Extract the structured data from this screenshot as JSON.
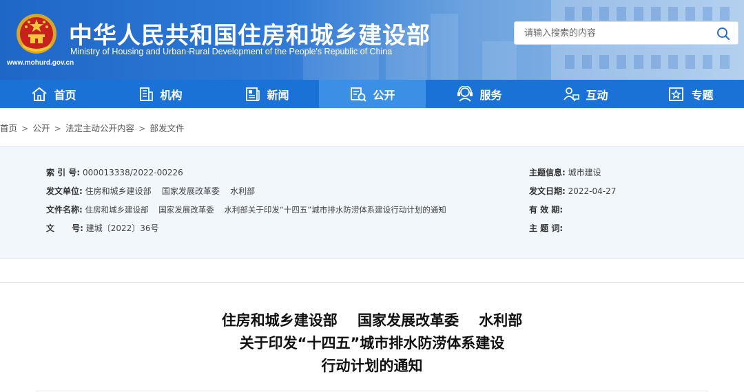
{
  "header": {
    "title": "中华人民共和国住房和城乡建设部",
    "subtitle_en": "Ministry of Housing and Urban-Rural Development of the People's Republic of China",
    "url": "www.mohurd.gov.cn"
  },
  "search": {
    "placeholder": "请输入搜索的内容",
    "icon": "search-icon"
  },
  "nav": {
    "items": [
      {
        "label": "首页",
        "icon": "home-icon"
      },
      {
        "label": "机构",
        "icon": "building-icon"
      },
      {
        "label": "新闻",
        "icon": "news-icon"
      },
      {
        "label": "公开",
        "icon": "disclosure-icon"
      },
      {
        "label": "服务",
        "icon": "service-icon"
      },
      {
        "label": "互动",
        "icon": "interaction-icon"
      },
      {
        "label": "专题",
        "icon": "topic-icon"
      }
    ],
    "active": "公开",
    "colors": {
      "bar": "#1a72d6",
      "active": "#3b90e6"
    }
  },
  "breadcrumb": [
    "首页",
    "公开",
    "法定主动公开内容",
    "部发文件"
  ],
  "info": {
    "index_label": "索 引 号:",
    "index_value": "000013338/2022-00226",
    "issuer_label": "发文单位:",
    "issuer_value": "住房和城乡建设部    国家发展改革委    水利部",
    "docname_label": "文件名称:",
    "docname_value": "住房和城乡建设部    国家发展改革委    水利部关于印发“十四五”城市排水防涝体系建设行动计划的通知",
    "docnum_label": "文      号:",
    "docnum_value": "建城〔2022〕36号",
    "topic_label": "主题信息:",
    "topic_value": "城市建设",
    "date_label": "发文日期:",
    "date_value": "2022-04-27",
    "validity_label": "有 效 期:",
    "validity_value": "",
    "keywords_label": "主 题 词:",
    "keywords_value": ""
  },
  "document": {
    "title_line1": "住房和城乡建设部    国家发展改革委    水利部",
    "title_line2": "关于印发“十四五”城市排水防涝体系建设",
    "title_line3": "行动计划的通知"
  }
}
